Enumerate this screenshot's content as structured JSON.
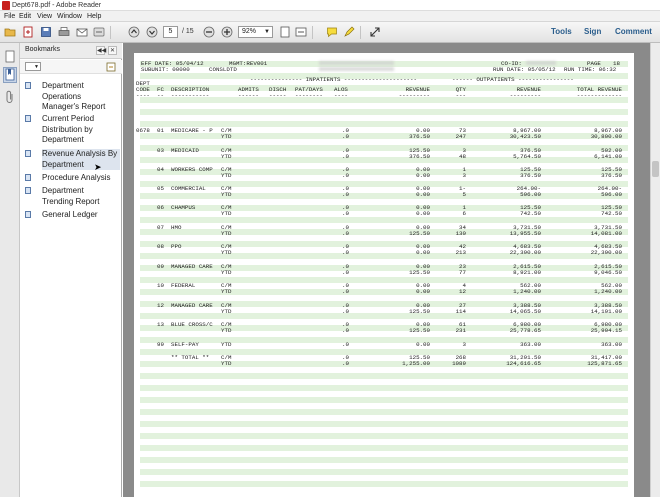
{
  "window": {
    "title": "Dept678.pdf - Adobe Reader"
  },
  "menu": [
    "File",
    "Edit",
    "View",
    "Window",
    "Help"
  ],
  "toolbar": {
    "page_current": "5",
    "page_total": "/ 15",
    "zoom": "92%",
    "tools": "Tools",
    "sign": "Sign",
    "comment": "Comment"
  },
  "bookmarks": {
    "title": "Bookmarks",
    "items": [
      {
        "lines": [
          "Department",
          "Operations",
          "Manager's Report"
        ]
      },
      {
        "lines": [
          "Current Period",
          "Distribution by",
          "Department"
        ]
      },
      {
        "lines": [
          "Revenue Analysis By",
          "Department"
        ]
      },
      {
        "lines": [
          "Procedure Analysis"
        ]
      },
      {
        "lines": [
          "Department",
          "Trending Report"
        ]
      },
      {
        "lines": [
          "General Ledger"
        ]
      }
    ]
  },
  "report": {
    "eff_date": "EFF DATE: 05/04/12",
    "mgmt": "MGMT:REV001",
    "subunit": "SUBUNIT: 00000",
    "consldtd": "CONSLDTD",
    "co_id": "CO-ID:",
    "run_date": "RUN DATE: 05/05/12",
    "page_label": "PAGE",
    "page_no": "18",
    "run_time": "RUN TIME: 06:32",
    "inpatients": "--------------- INPATIENTS ---------------------",
    "outpatients": "------ OUTPATIENTS ----------------",
    "hdr_dept": "DEPT",
    "hdr_code": "CODE",
    "hdr_fc": "FC",
    "hdr_desc": "DESCRIPTION",
    "hdr_admits": "ADMITS",
    "hdr_disch": "DISCH",
    "hdr_patdays": "PAT/DAYS",
    "hdr_alos": "ALOS",
    "hdr_revenue": "REVENUE",
    "hdr_qty": "QTY",
    "hdr_outrev": "REVENUE",
    "hdr_total": "TOTAL REVENUE",
    "dept_code": "0678",
    "dash_code": "----",
    "dash_fc": "--",
    "dash_desc": "-----------",
    "dash_admits": "------",
    "dash_disch": "-----",
    "dash_patdays": "--------",
    "dash_alos": "----",
    "dash_rev": "---------",
    "dash_qty": "---",
    "dash_outrev": "---------",
    "dash_total": "-------------",
    "rows": [
      {
        "fc": "01",
        "desc": "MEDICARE - P",
        "cm": [
          "C/M",
          ".0",
          "0.00",
          "73",
          "8,967.00",
          "8,967.00"
        ],
        "ytd": [
          "YTD",
          ".0",
          "376.50",
          "247",
          "30,423.50",
          "30,800.00"
        ]
      },
      {
        "fc": "03",
        "desc": "MEDICAID",
        "cm": [
          "C/M",
          ".0",
          "125.50",
          "3",
          "376.50",
          "502.00"
        ],
        "ytd": [
          "YTD",
          ".0",
          "376.50",
          "48",
          "5,764.50",
          "6,141.00"
        ]
      },
      {
        "fc": "04",
        "desc": "WORKERS COMP",
        "cm": [
          "C/M",
          ".0",
          "0.00",
          "1",
          "125.50",
          "125.50"
        ],
        "ytd": [
          "YTD",
          ".0",
          "0.00",
          "3",
          "376.50",
          "376.50"
        ]
      },
      {
        "fc": "05",
        "desc": "COMMERCIAL",
        "cm": [
          "C/M",
          ".0",
          "0.00",
          "1-",
          "264.00-",
          "264.00-"
        ],
        "ytd": [
          "YTD",
          ".0",
          "0.00",
          "5",
          "596.00",
          "596.00"
        ]
      },
      {
        "fc": "06",
        "desc": "CHAMPUS",
        "cm": [
          "C/M",
          ".0",
          "0.00",
          "1",
          "125.50",
          "125.50"
        ],
        "ytd": [
          "YTD",
          ".0",
          "0.00",
          "6",
          "742.50",
          "742.50"
        ]
      },
      {
        "fc": "07",
        "desc": "HMO",
        "cm": [
          "C/M",
          ".0",
          "0.00",
          "34",
          "3,731.50",
          "3,731.50"
        ],
        "ytd": [
          "YTD",
          ".0",
          "125.50",
          "130",
          "13,955.50",
          "14,081.00"
        ]
      },
      {
        "fc": "08",
        "desc": "PPO",
        "cm": [
          "C/M",
          ".0",
          "0.00",
          "42",
          "4,683.50",
          "4,683.50"
        ],
        "ytd": [
          "YTD",
          ".0",
          "0.00",
          "213",
          "22,390.00",
          "22,390.00"
        ]
      },
      {
        "fc": "09",
        "desc": "MANAGED CARE",
        "cm": [
          "C/M",
          ".0",
          "0.00",
          "23",
          "2,615.50",
          "2,615.50"
        ],
        "ytd": [
          "YTD",
          ".0",
          "125.50",
          "77",
          "8,921.00",
          "9,046.50"
        ]
      },
      {
        "fc": "10",
        "desc": "FEDERAL",
        "cm": [
          "C/M",
          ".0",
          "0.00",
          "4",
          "562.00",
          "562.00"
        ],
        "ytd": [
          "YTD",
          ".0",
          "0.00",
          "12",
          "1,240.00",
          "1,240.00"
        ]
      },
      {
        "fc": "12",
        "desc": "MANAGED CARE",
        "cm": [
          "C/M",
          ".0",
          "0.00",
          "27",
          "3,388.50",
          "3,388.50"
        ],
        "ytd": [
          "YTD",
          ".0",
          "125.50",
          "114",
          "14,065.50",
          "14,191.00"
        ]
      },
      {
        "fc": "13",
        "desc": "BLUE CROSS/C",
        "cm": [
          "C/M",
          ".0",
          "0.00",
          "61",
          "6,980.00",
          "6,980.00"
        ],
        "ytd": [
          "YTD",
          ".0",
          "125.50",
          "231",
          "25,778.65",
          "25,904.15"
        ]
      },
      {
        "fc": "99",
        "desc": "SELF-PAY",
        "cm": [
          "YTD",
          ".0",
          "0.00",
          "3",
          "363.00",
          "363.00"
        ],
        "ytd": null
      },
      {
        "fc": "",
        "desc": "** TOTAL **",
        "cm": [
          "C/M",
          ".0",
          "125.50",
          "268",
          "31,291.50",
          "31,417.00"
        ],
        "ytd": [
          "YTD",
          ".0",
          "1,255.00",
          "1089",
          "124,616.65",
          "125,871.65"
        ]
      }
    ]
  }
}
